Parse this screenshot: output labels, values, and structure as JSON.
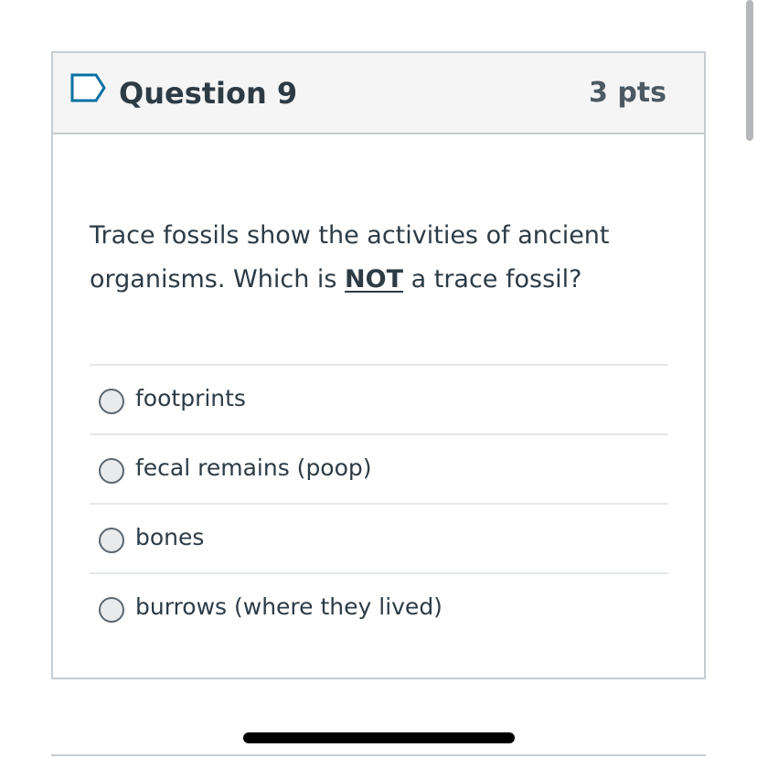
{
  "question": {
    "title": "Question 9",
    "points": "3 pts",
    "flag_icon": "flag-question-icon",
    "prompt_before": "Trace fossils show the activities of ancient organisms.  Which is ",
    "prompt_emphasis": "NOT",
    "prompt_after": "  a trace fossil?"
  },
  "answers": [
    {
      "label": "footprints"
    },
    {
      "label": "fecal remains (poop)"
    },
    {
      "label": "bones"
    },
    {
      "label": "burrows (where they lived)"
    }
  ],
  "colors": {
    "header_background": "#f5f5f5",
    "border": "#c7cdd1",
    "text": "#2d3b45",
    "radio_fill": "#e9eaec"
  }
}
